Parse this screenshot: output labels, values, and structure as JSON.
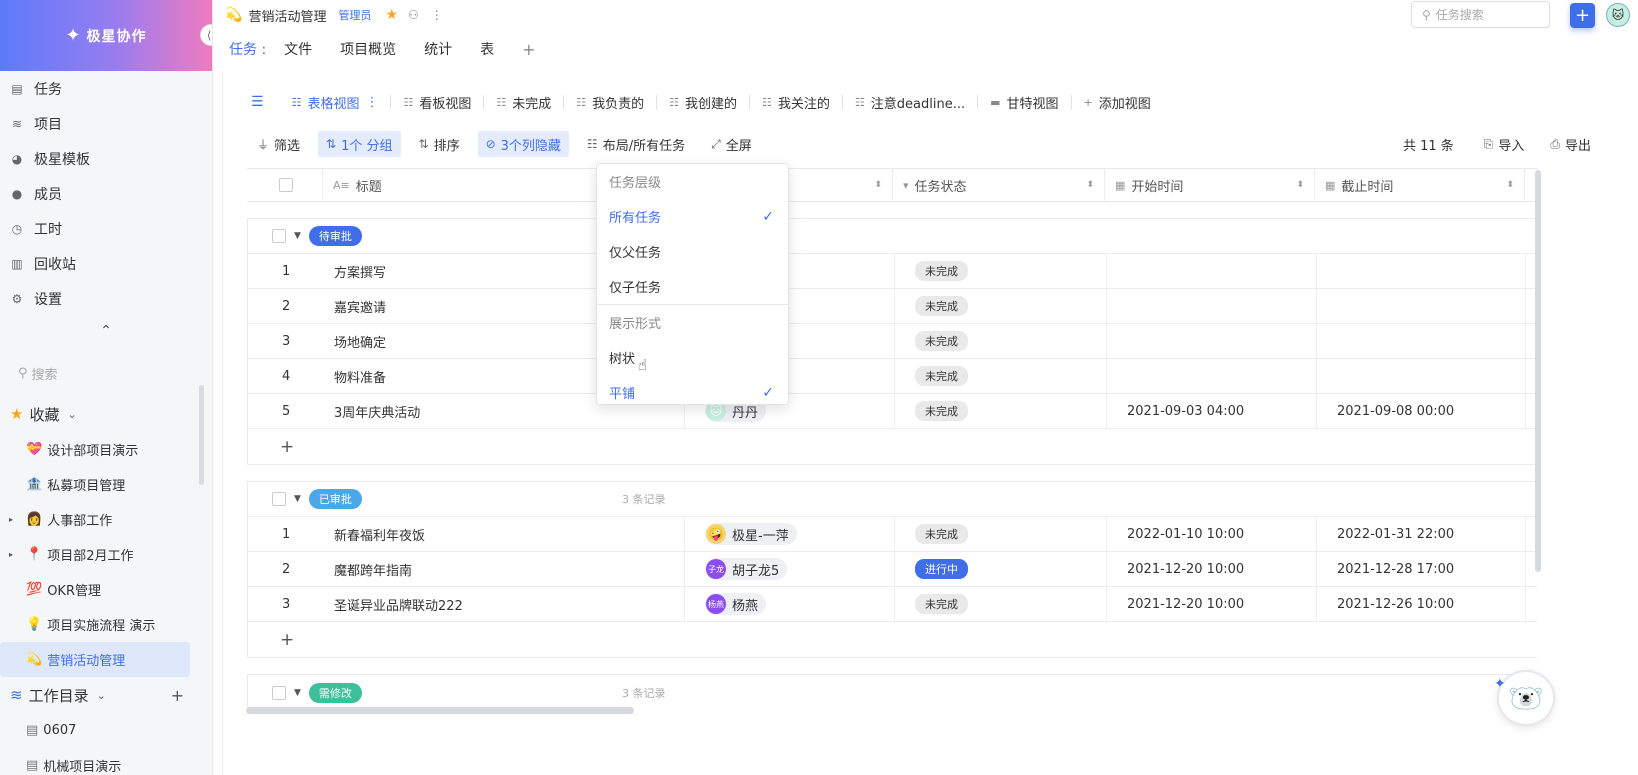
{
  "brand": {
    "name": "极星协作",
    "logo_icon": "✦",
    "collapse_icon": "⟨|"
  },
  "nav": [
    {
      "label": "任务",
      "icon": "task-icon",
      "glyph": "▤"
    },
    {
      "label": "项目",
      "icon": "layers-icon",
      "glyph": "≋"
    },
    {
      "label": "极星模板",
      "icon": "template-icon",
      "glyph": "◕"
    },
    {
      "label": "成员",
      "icon": "user-icon",
      "glyph": "●"
    },
    {
      "label": "工时",
      "icon": "clock-icon",
      "glyph": "◷"
    },
    {
      "label": "回收站",
      "icon": "trash-icon",
      "glyph": "▥"
    },
    {
      "label": "设置",
      "icon": "gear-icon",
      "glyph": "⚙"
    }
  ],
  "sidebar_search": {
    "placeholder": "搜索"
  },
  "favorites": {
    "label": "收藏",
    "items": [
      {
        "label": "设计部项目演示",
        "emoji": "💝",
        "expandable": false
      },
      {
        "label": "私募项目管理",
        "emoji": "🏦",
        "expandable": false
      },
      {
        "label": "人事部工作",
        "emoji": "👩",
        "expandable": true
      },
      {
        "label": "项目部2月工作",
        "emoji": "📍",
        "expandable": true
      },
      {
        "label": "OKR管理",
        "emoji": "💯",
        "expandable": false
      },
      {
        "label": "项目实施流程 演示",
        "emoji": "💡",
        "expandable": false
      },
      {
        "label": "营销活动管理",
        "emoji": "💫",
        "expandable": false,
        "active": true
      }
    ]
  },
  "workdir": {
    "label": "工作目录",
    "items": [
      {
        "label": "0607"
      },
      {
        "label": "机械项目演示"
      }
    ]
  },
  "header": {
    "project_icon": "💫",
    "project_title": "营销活动管理",
    "role": "管理员",
    "search_placeholder": "任务搜索",
    "add_label": "+",
    "avatar": "🐱"
  },
  "tabs": {
    "lead": "任务 :",
    "items": [
      "文件",
      "项目概览",
      "统计",
      "表"
    ],
    "plus": "+"
  },
  "views": [
    {
      "label": "表格视图",
      "active": true
    },
    {
      "label": "看板视图"
    },
    {
      "label": "未完成"
    },
    {
      "label": "我负责的"
    },
    {
      "label": "我创建的"
    },
    {
      "label": "我关注的"
    },
    {
      "label": "注意deadline..."
    },
    {
      "label": "甘特视图"
    },
    {
      "label": "添加视图"
    }
  ],
  "toolbar": {
    "filter": "筛选",
    "group": "1个 分组",
    "sort": "排序",
    "hidden": "3个列隐藏",
    "layout": "布局/所有任务",
    "fullscreen": "全屏",
    "count": "共 11 条",
    "import": "导入",
    "export": "导出"
  },
  "columns": {
    "title": "标题",
    "status": "任务状态",
    "start": "开始时间",
    "end": "截止时间"
  },
  "groups": [
    {
      "label": "待审批",
      "color": "#3f6ee8",
      "count": "",
      "rows": [
        {
          "num": "1",
          "title": "方案撰写",
          "owner": "",
          "status": "未完成",
          "start": "",
          "end": ""
        },
        {
          "num": "2",
          "title": "嘉宾邀请",
          "owner": "",
          "status": "未完成",
          "start": "",
          "end": ""
        },
        {
          "num": "3",
          "title": "场地确定",
          "owner": "",
          "status": "未完成",
          "start": "",
          "end": ""
        },
        {
          "num": "4",
          "title": "物料准备",
          "owner": "",
          "status": "未完成",
          "start": "",
          "end": ""
        },
        {
          "num": "5",
          "title": "3周年庆典活动",
          "owner": "丹丹",
          "owner_avatar": "🐱",
          "owner_color": "#c7efe0",
          "status": "未完成",
          "start": "2021-09-03 04:00",
          "end": "2021-09-08 00:00"
        }
      ]
    },
    {
      "label": "已审批",
      "color": "#4aa8e8",
      "count": "3 条记录",
      "rows": [
        {
          "num": "1",
          "title": "新春福利年夜饭",
          "owner": "极星-一萍",
          "owner_avatar": "🤪",
          "owner_color": "#f6d36b",
          "status": "未完成",
          "start": "2022-01-10 10:00",
          "end": "2022-01-31 22:00"
        },
        {
          "num": "2",
          "title": "魔都跨年指南",
          "owner": "胡子龙5",
          "owner_avatar": "子龙",
          "owner_color": "#8b4cf0",
          "status": "进行中",
          "doing": true,
          "start": "2021-12-20 10:00",
          "end": "2021-12-28 17:00"
        },
        {
          "num": "3",
          "title": "圣诞异业品牌联动222",
          "owner": "杨燕",
          "owner_avatar": "杨燕",
          "owner_color": "#8b4cf0",
          "status": "未完成",
          "start": "2021-12-20 10:00",
          "end": "2021-12-26 10:00"
        }
      ]
    },
    {
      "label": "需修改",
      "color": "#3cbf9a",
      "count": "3 条记录",
      "rows": []
    }
  ],
  "dropdown": {
    "items": [
      {
        "label": "任务层级",
        "type": "head"
      },
      {
        "label": "所有任务",
        "type": "sel"
      },
      {
        "label": "仅父任务",
        "type": "opt"
      },
      {
        "label": "仅子任务",
        "type": "opt"
      },
      {
        "label": "展示形式",
        "type": "head",
        "sep_before": true
      },
      {
        "label": "树状",
        "type": "opt"
      },
      {
        "label": "平铺",
        "type": "sel"
      }
    ]
  },
  "cursor": "☝",
  "assistant_icon": "🐻‍❄️"
}
